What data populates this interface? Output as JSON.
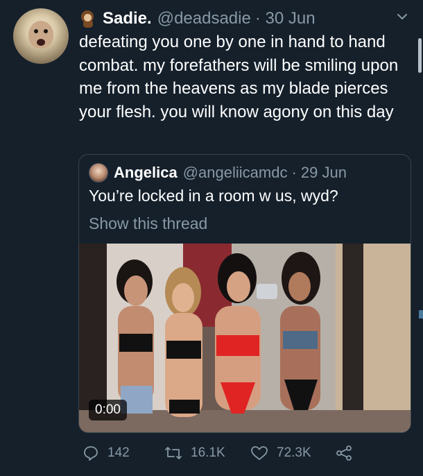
{
  "tweet": {
    "author_name": "Sadie.",
    "author_handle": "@deadsadie",
    "date": "· 30 Jun",
    "text": "defeating you one by one in hand to hand combat. my forefathers will be smiling upon me from the heavens as my blade pierces your flesh. you will know agony on this day",
    "name_emoji_icon": "monkey-emoji-icon"
  },
  "quoted_tweet": {
    "author_name": "Angelica",
    "author_handle": "@angeliicamdc",
    "date": "· 29 Jun",
    "text": "You’re locked in a room w us, wyd?",
    "show_thread": "Show this thread",
    "video_time": "0:00"
  },
  "actions": {
    "replies": "142",
    "retweets": "16.1K",
    "likes": "72.3K"
  },
  "colors": {
    "background": "#15202b",
    "secondary_text": "#8899a6",
    "border": "#38444d",
    "primary_text": "#ffffff"
  }
}
